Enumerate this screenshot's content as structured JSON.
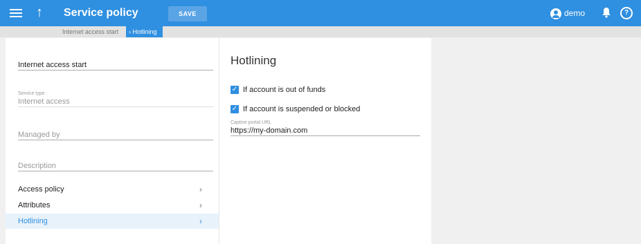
{
  "header": {
    "title": "Service policy",
    "save_label": "SAVE",
    "user_name": "demo",
    "help_glyph": "?",
    "accent_color": "#2f8fe0"
  },
  "breadcrumb": {
    "items": [
      "Internet access start",
      "Hotlining"
    ]
  },
  "left": {
    "name_value": "Internet access start",
    "service_type_label": "Service type",
    "service_type_value": "Internet access",
    "managed_by_placeholder": "Managed by",
    "description_placeholder": "Description",
    "nav": [
      {
        "label": "Access policy"
      },
      {
        "label": "Attributes"
      },
      {
        "label": "Hotlining"
      }
    ]
  },
  "hotlining": {
    "title": "Hotlining",
    "checkbox_funds": "If account is out of funds",
    "checkbox_suspended": "If account is suspended or blocked",
    "url_label": "Captive portal URL",
    "url_value": "https://my-domain.com"
  }
}
